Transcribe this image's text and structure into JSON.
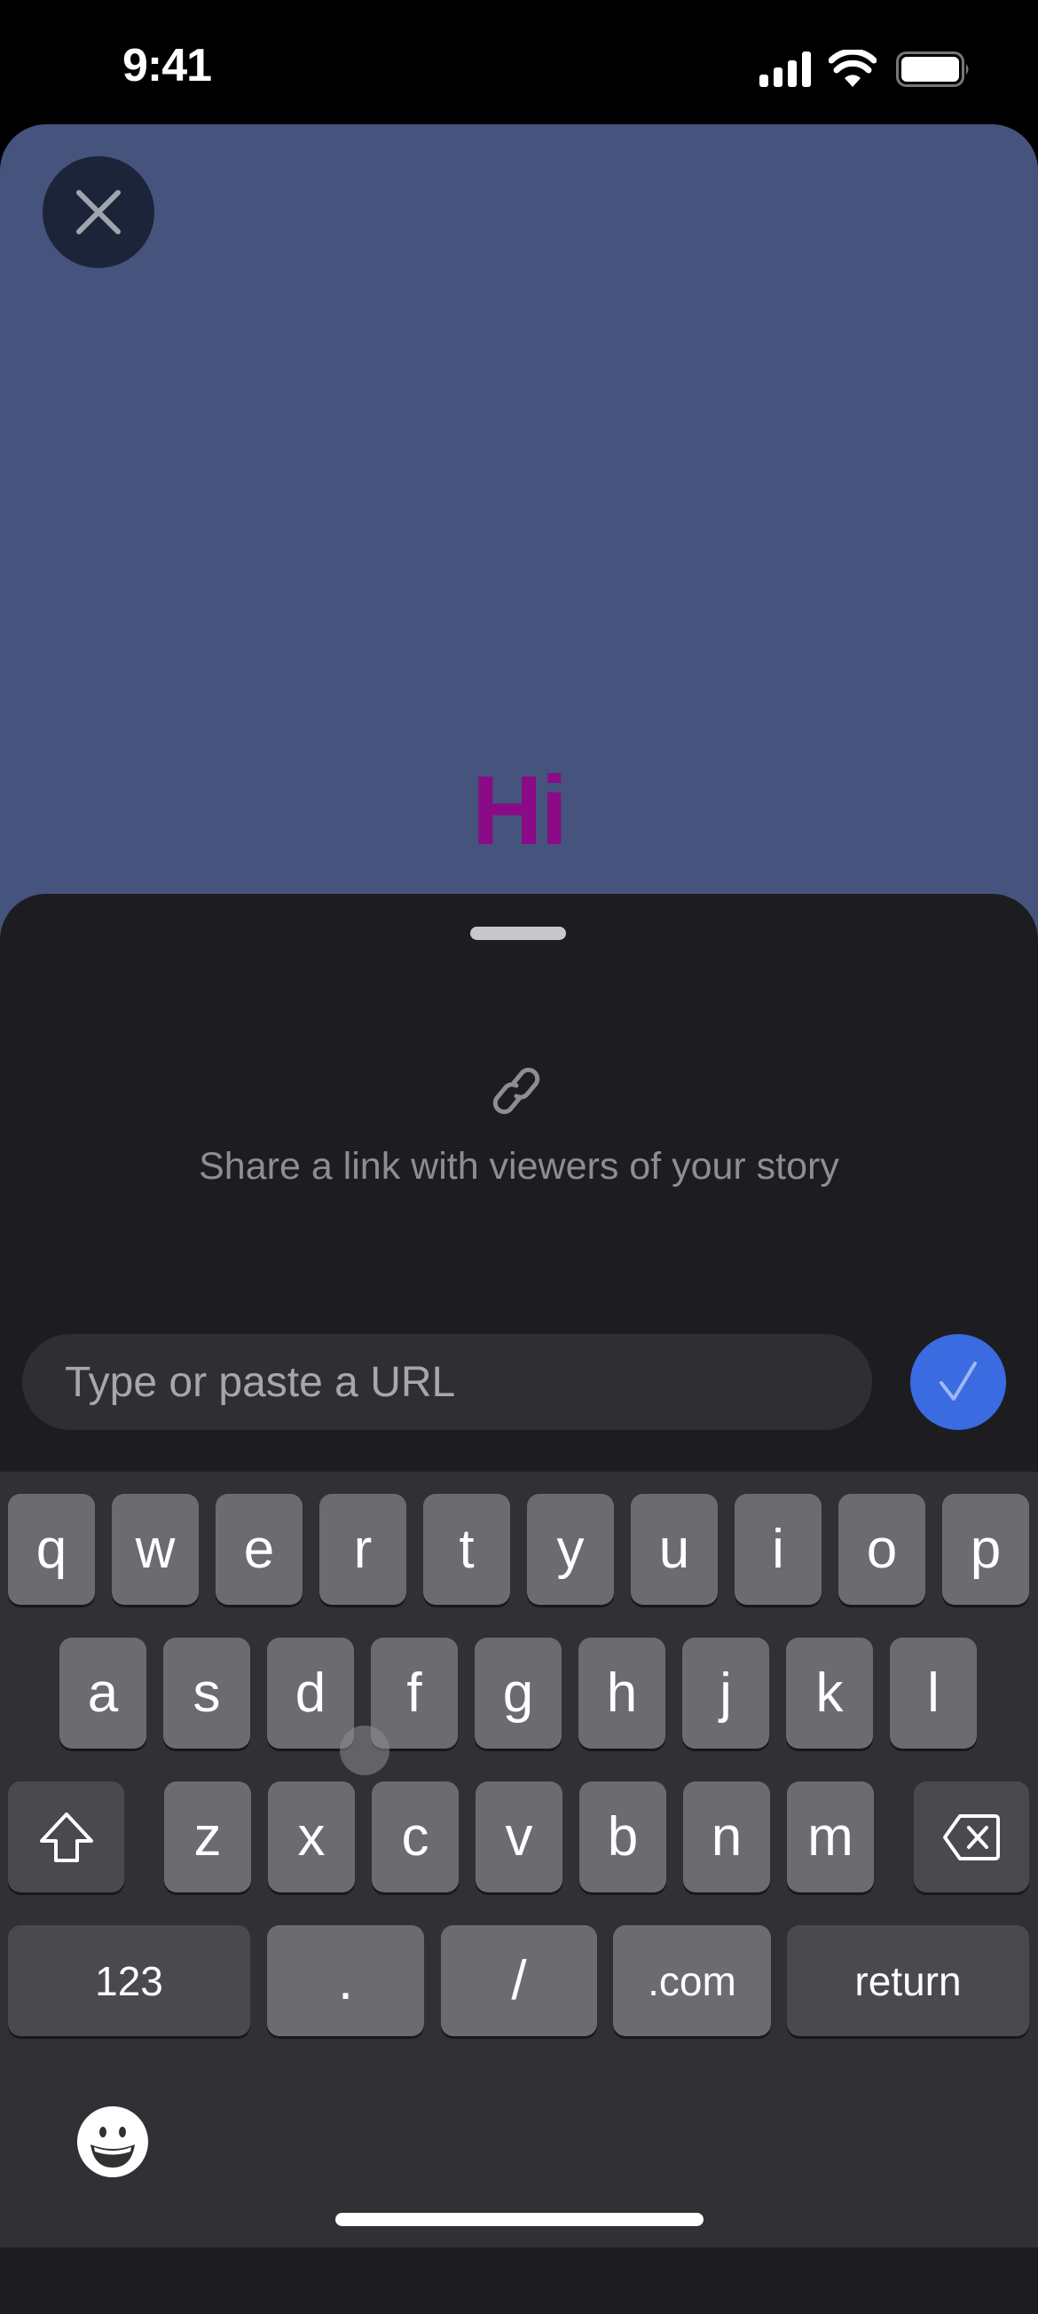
{
  "status_bar": {
    "time": "9:41",
    "signal_icon": "cellular-signal-icon",
    "wifi_icon": "wifi-icon",
    "battery_icon": "battery-full-icon"
  },
  "story": {
    "background_color": "#45537d",
    "close_icon": "close-icon",
    "text": "Hi",
    "text_color": "#8b0a86"
  },
  "link_sheet": {
    "icon": "link-icon",
    "description": "Share a link with viewers of your story",
    "url_input": {
      "value": "",
      "placeholder": "Type or paste a URL"
    },
    "confirm_icon": "checkmark-icon",
    "accent_color": "#3a6be0"
  },
  "keyboard": {
    "row1": [
      "q",
      "w",
      "e",
      "r",
      "t",
      "y",
      "u",
      "i",
      "o",
      "p"
    ],
    "row2": [
      "a",
      "s",
      "d",
      "f",
      "g",
      "h",
      "j",
      "k",
      "l"
    ],
    "row3": [
      "z",
      "x",
      "c",
      "v",
      "b",
      "n",
      "m"
    ],
    "shift_icon": "shift-icon",
    "delete_icon": "delete-backspace-icon",
    "numbers_label": "123",
    "period_label": ".",
    "slash_label": "/",
    "dotcom_label": ".com",
    "return_label": "return",
    "emoji_icon": "emoji-icon"
  }
}
